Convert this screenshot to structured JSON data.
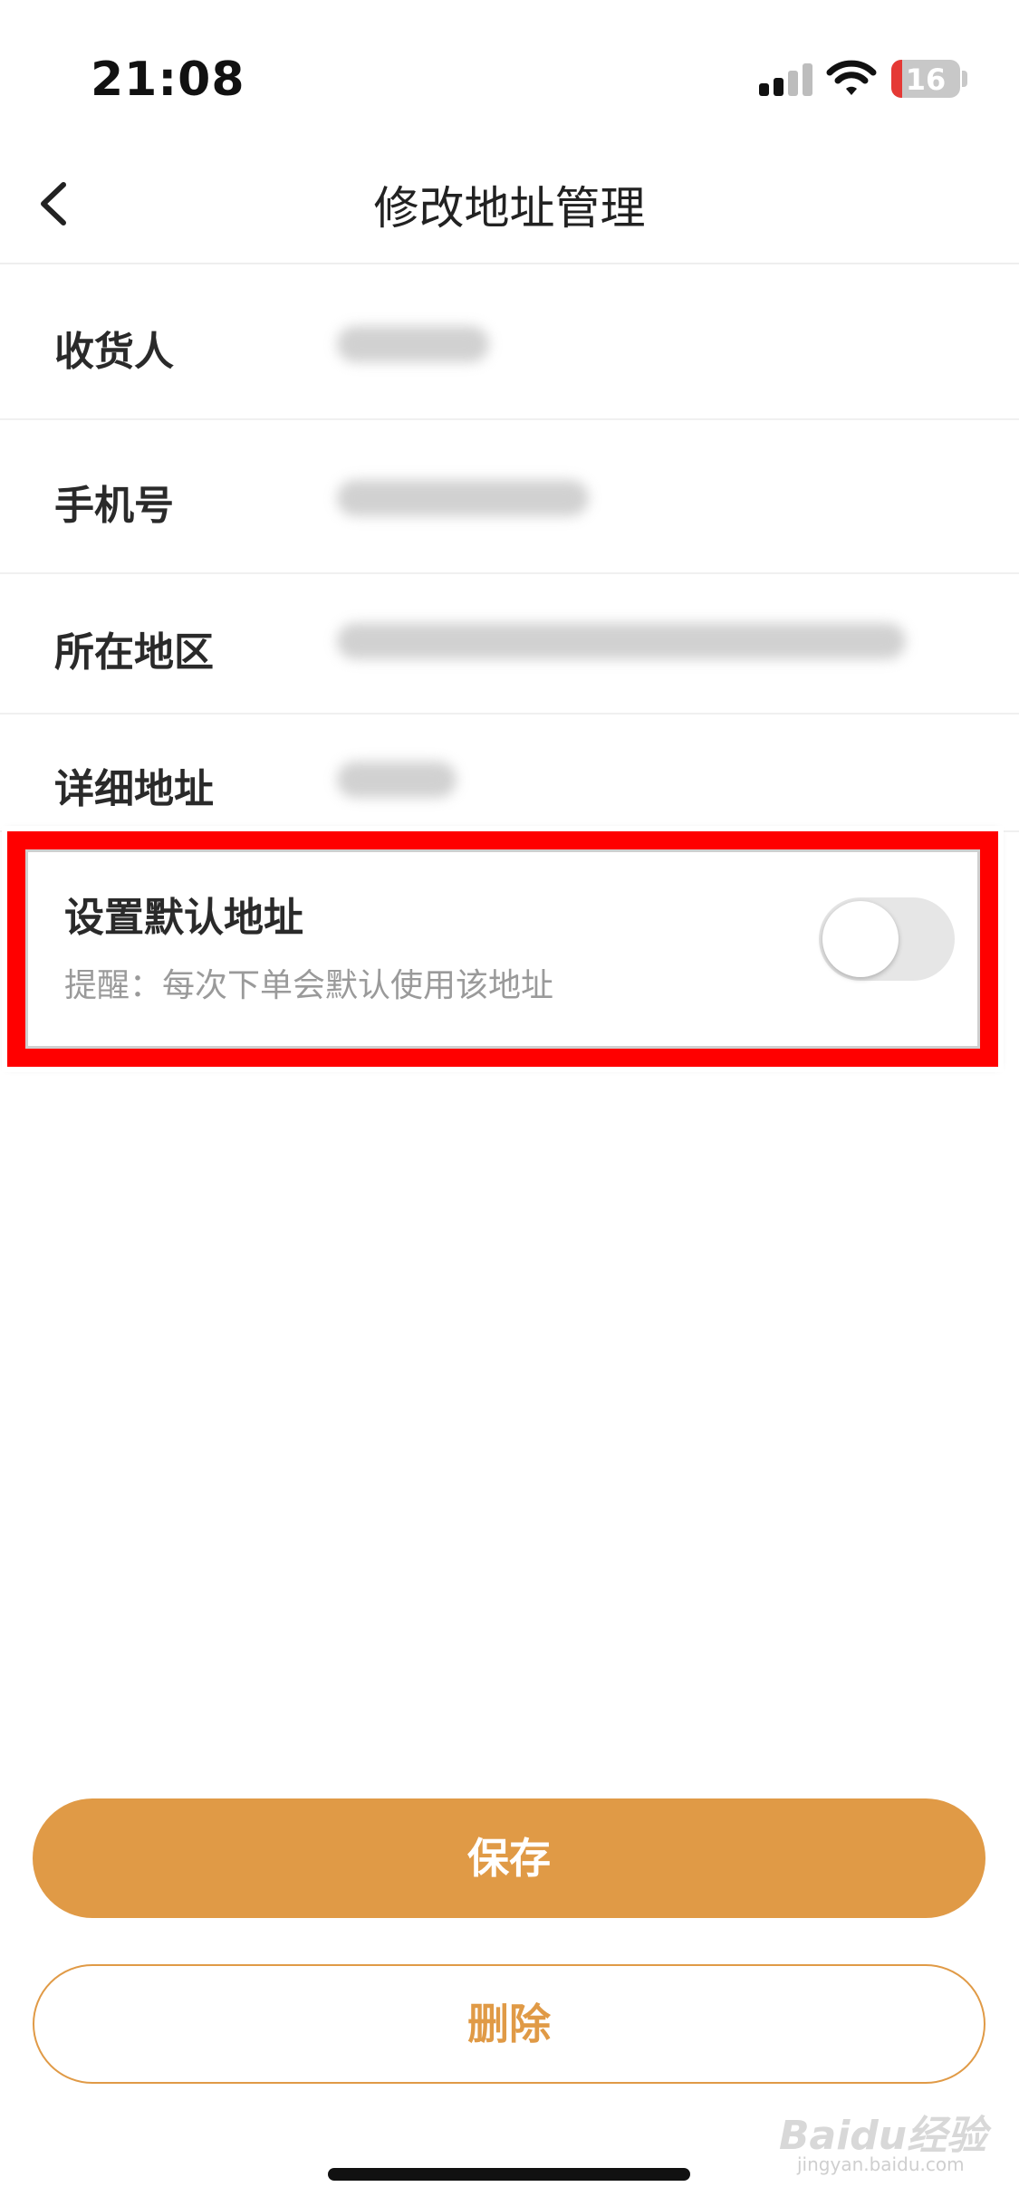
{
  "status_bar": {
    "time": "21:08",
    "battery_level": "16",
    "icons": [
      "cellular-signal-icon",
      "wifi-icon",
      "battery-icon"
    ]
  },
  "nav": {
    "title": "修改地址管理",
    "back_icon": "chevron-left-icon"
  },
  "form": {
    "rows": [
      {
        "label": "收货人"
      },
      {
        "label": "手机号"
      },
      {
        "label": "所在地区"
      },
      {
        "label": "详细地址"
      }
    ],
    "default_address": {
      "title": "设置默认地址",
      "hint": "提醒：每次下单会默认使用该地址",
      "toggle_on": false
    }
  },
  "actions": {
    "save_label": "保存",
    "delete_label": "删除"
  },
  "watermark": {
    "text": "Baidu经验",
    "sub": "jingyan.baidu.com"
  },
  "colors": {
    "accent": "#e09a46",
    "highlight": "#ff0000",
    "toggle_off": "#e6e6e6"
  }
}
